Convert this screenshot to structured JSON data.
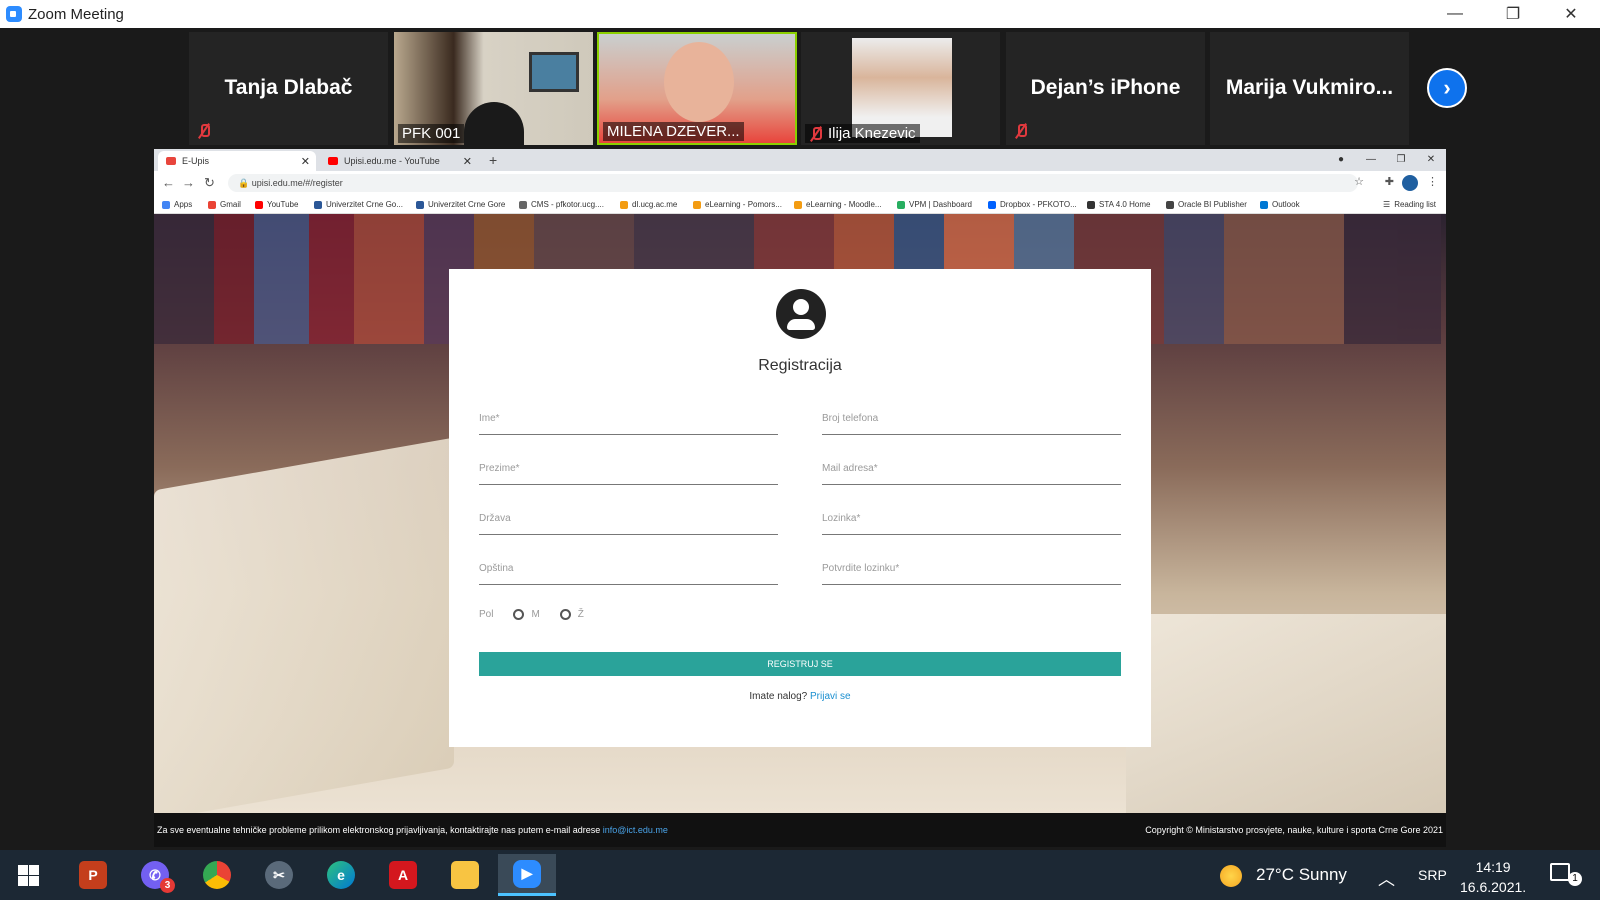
{
  "zoom": {
    "title": "Zoom Meeting",
    "participants": [
      {
        "name": "Tanja Dlabač",
        "muted": true
      },
      {
        "name": "PFK 001",
        "muted": false
      },
      {
        "name": "MILENA DZEVER...",
        "muted": false
      },
      {
        "name": "Ilija Knezevic",
        "muted": true
      },
      {
        "name": "Dejan’s iPhone",
        "muted": true
      },
      {
        "name": "Marija  Vukmiro...",
        "muted": false
      }
    ]
  },
  "browser": {
    "tabs": [
      {
        "title": "E-Upis",
        "active": true
      },
      {
        "title": "Upisi.edu.me - YouTube",
        "active": false
      }
    ],
    "url": "upisi.edu.me/#/register",
    "bookmarks": [
      "Apps",
      "Gmail",
      "YouTube",
      "Univerzitet Crne Go...",
      "Univerzitet Crne Gore",
      "CMS - pfkotor.ucg....",
      "dl.ucg.ac.me",
      "eLearning - Pomors...",
      "eLearning - Moodle...",
      "VPM | Dashboard",
      "Dropbox - PFKOTO...",
      "STA 4.0 Home",
      "Oracle BI Publisher",
      "Outlook"
    ],
    "reading_list": "Reading list"
  },
  "form": {
    "title": "Registracija",
    "fields": {
      "ime": "Ime*",
      "broj_telefona": "Broj telefona",
      "prezime": "Prezime*",
      "mail": "Mail adresa*",
      "drzava": "Država",
      "lozinka": "Lozinka*",
      "opstina": "Opština",
      "potvrda": "Potvrdite lozinku*"
    },
    "gender_label": "Pol",
    "gender_m": "M",
    "gender_z": "Ž",
    "submit": "REGISTRUJ SE",
    "have_account": "Imate nalog?",
    "login_link": "Prijavi se"
  },
  "footer": {
    "left_text": "Za sve eventualne tehničke probleme prilikom elektronskog prijavljivanja, kontaktirajte nas putem e-mail adrese",
    "email": "info@ict.edu.me",
    "copyright": "Copyright © Ministarstvo prosvjete, nauke, kulture i sporta Crne Gore 2021"
  },
  "taskbar": {
    "weather": "27°C  Sunny",
    "lang": "SRP",
    "time": "14:19",
    "date": "16.6.2021.",
    "viber_badge": "3",
    "notif_count": "1"
  }
}
